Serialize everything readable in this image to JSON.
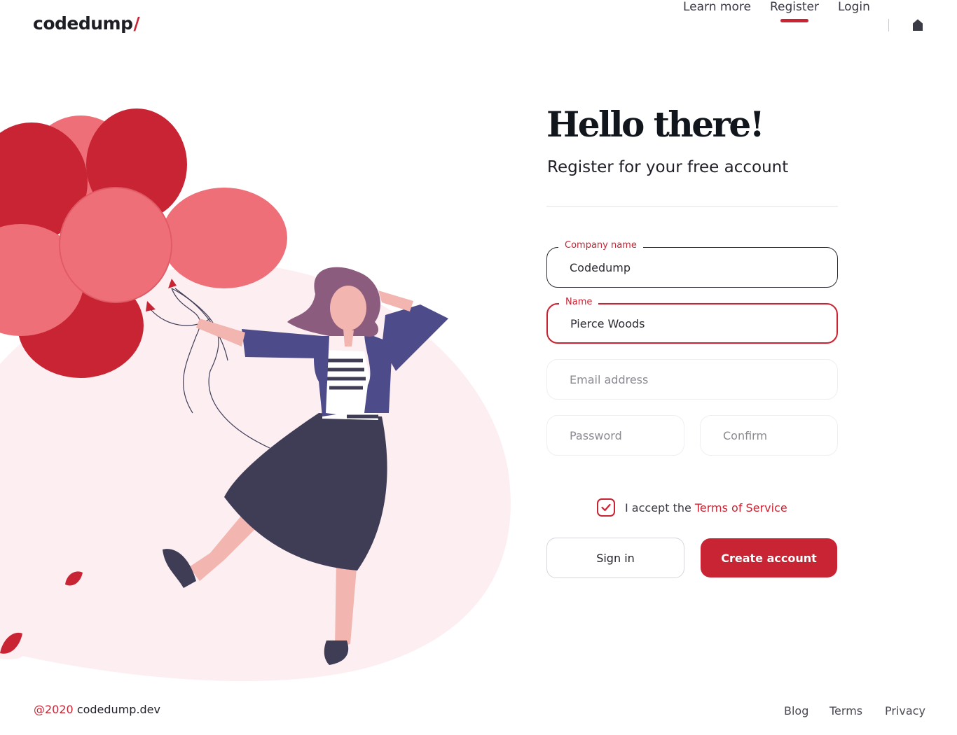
{
  "brand": {
    "name": "codedump",
    "slash": "/"
  },
  "nav": {
    "items": [
      {
        "label": "Learn more",
        "active": false
      },
      {
        "label": "Register",
        "active": true
      },
      {
        "label": "Login",
        "active": false
      }
    ],
    "home_icon": "home-icon"
  },
  "hero": {
    "title": "Hello there!",
    "subtitle": "Register for your free account"
  },
  "form": {
    "company": {
      "label": "Company name",
      "value": "Codedump",
      "placeholder": "Company name"
    },
    "name": {
      "label": "Name",
      "value": "Pierce Woods",
      "placeholder": "Name"
    },
    "email": {
      "value": "",
      "placeholder": "Email address"
    },
    "password": {
      "value": "",
      "placeholder": "Password"
    },
    "confirm": {
      "value": "",
      "placeholder": "Confirm"
    },
    "terms": {
      "text": "I accept the",
      "link": "Terms of Service",
      "checked": true
    },
    "sign_in_label": "Sign in",
    "create_label": "Create account"
  },
  "footer": {
    "year": "@2020",
    "domain": "codedump.dev",
    "links": [
      "Blog",
      "Terms",
      "Privacy"
    ]
  },
  "colors": {
    "accent": "#c82433",
    "balloon_light": "#ef6f78",
    "skirt": "#3f3d56",
    "jacket": "#4d4b8a",
    "background_blob": "#fdeff1"
  }
}
